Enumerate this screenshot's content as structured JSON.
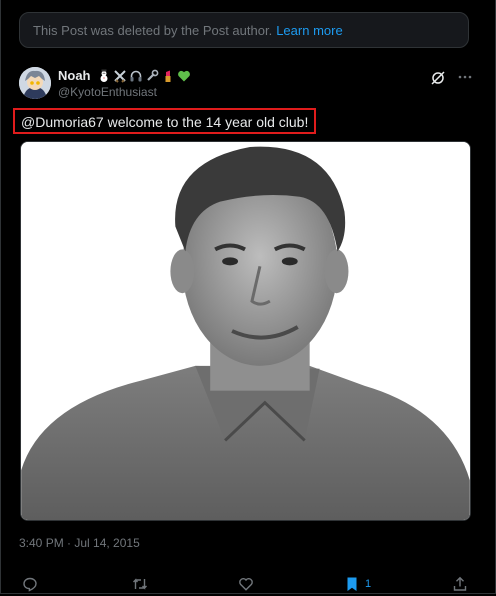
{
  "banner": {
    "text": "This Post was deleted by the Post author.",
    "link_text": "Learn more"
  },
  "post": {
    "author_name": "Noah",
    "author_handle": "@KyotoEnthusiast",
    "name_emojis": [
      "snowman-icon",
      "crossed-swords-icon",
      "headphones-icon",
      "wrench-icon",
      "lipstick-icon",
      "green-heart-icon"
    ],
    "text": "@Dumoria67 welcome to the 14 year old club!",
    "timestamp": "3:40 PM · Jul 14, 2015",
    "bookmark_count": "1"
  },
  "colors": {
    "accent": "#1d9bf0",
    "highlight_box": "#e01c1c",
    "muted_text": "#71767b"
  }
}
